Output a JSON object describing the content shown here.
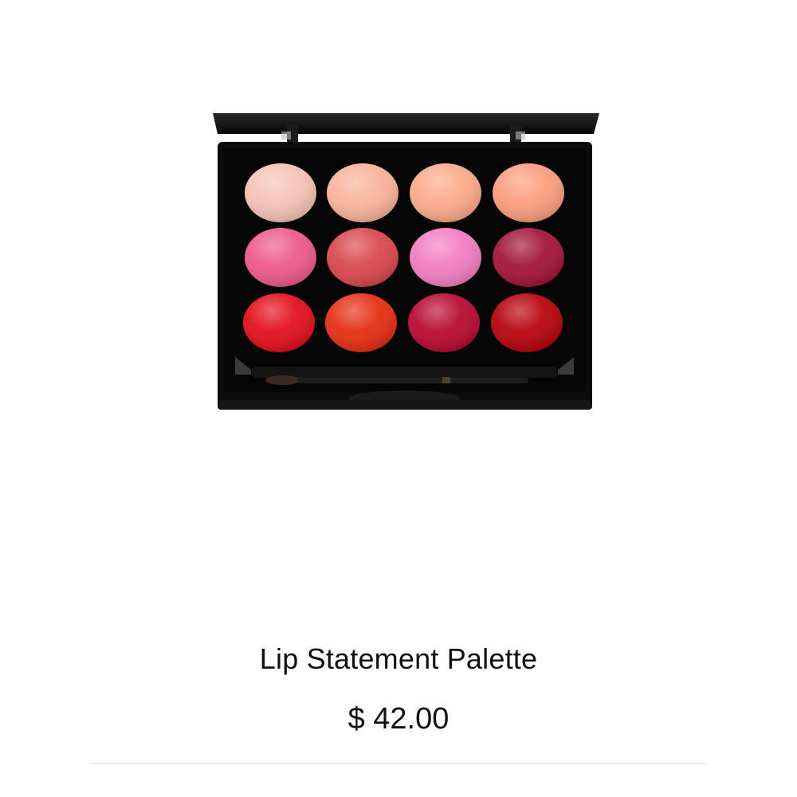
{
  "product": {
    "name": "Lip Statement Palette",
    "price": "$ 42.00",
    "swatches": [
      [
        "#f6c3b6",
        "#f9b39a",
        "#fcaa8a",
        "#fc9e7e"
      ],
      [
        "#ee5a8c",
        "#d9484e",
        "#f27ec2",
        "#a2153b"
      ],
      [
        "#e2101c",
        "#e52f13",
        "#b80b31",
        "#b7040e"
      ]
    ],
    "palette_case_color": "#0b0b0b"
  }
}
